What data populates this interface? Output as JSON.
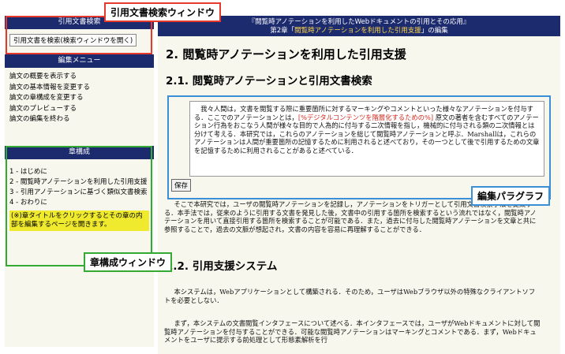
{
  "sidebar": {
    "search_header": "引用文書検索",
    "search_button": "引用文書を検索(検索ウィンドウを開く)",
    "edit_header": "編集メニュー",
    "edit_items": [
      "論文の概要を表示する",
      "論文の基本情報を変更する",
      "論文の章構成を変更する",
      "論文のプレビューする",
      "論文の編集を終わる"
    ],
    "chapter_header": "章構成",
    "chapter_items": [
      "1 - はじめに",
      "2 - 閲覧時アノテーションを利用した引用支援",
      "3 - 引用アノテーションに基づく類似文書検索",
      "4 - おわりに"
    ],
    "chapter_note": "(※)章タイトルをクリックするとその章の内部を編集するページを開きます。"
  },
  "main": {
    "header_line1": "『閲覧時アノテーションを利用したWebドキュメントの引用とその応用』",
    "header_line2_prefix": "第2章「",
    "header_line2_highlight": "閲覧時アノテーションを利用した引用支援",
    "header_line2_suffix": "」の編集",
    "h1": "2. 閲覧時アノテーションを利用した引用支援",
    "h2_1": "2.1. 閲覧時アノテーションと引用文書検索",
    "edit_para_a": "我々人間は，文書を閲覧する際に重要箇所に対するマーキングやコメントといった様々なアノテーションを付与する．ここでのアノテーションとは，",
    "edit_para_red": "[%デジタルコンテンツを階層化するための%]",
    "edit_para_b": " 原文の著者を含むすべてのアノテーション行為をおこなう人間が様々な目的で人為的に付与する二次情報を指し，機械的に付与される類の二次情報とは分けて考える．本研究では，これらのアノテーションを総じて閲覧時アノテーションと呼ぶ．Marshallは，これらのアノテーションは人間が重要箇所の記憶するために利用されると述べており，その一つとして後で引用するための文章を記憶するために利用されることがあると述べている．",
    "save_button": "保存",
    "para2": "そこで本研究では，ユーザの閲覧時アノテーションを記録し，アノテーションをトリガーとして引用文書検索手法を提案する．本手法では，従来のように引用する文書を発見した後，文書中の引用する箇所を検索するという流れではなく，閲覧時アノテーションを用いて直接引用する箇所を検索することが可能である．また，過去に付与した閲覧時アノテーションを文章と共に参照することで，過去の文脈が想起され，文書の内容を容易に再理解することができる．",
    "h2_2": "2.2. 引用支援システム",
    "para3": "本システムは，Webアプリケーションとして構築される．そのため，ユーザはWebブラウザ以外の特殊なクライアントソフトを必要としない．",
    "para4": "まず，本システムの文書閲覧インタフェースについて述べる．本インタフェースでは，ユーザがWebドキュメントに対して閲覧時アノテーションを付与することができる．可能な閲覧時アノテーションはマーキングとコメントである．まず，Webドキュメントをユーザに提示する前処理として形態素解析を行"
  },
  "callouts": {
    "search_window": "引用文書検索ウィンドウ",
    "edit_paragraph": "編集パラグラフ",
    "chapter_window": "章構成ウィンドウ"
  },
  "colors": {
    "header_bg": "#1c2a6e",
    "highlight": "#ffd84a",
    "note_yellow": "#f0ea2e",
    "red_frame": "#e53a2b",
    "green_frame": "#33aa33",
    "blue_frame": "#3b8fd6"
  }
}
